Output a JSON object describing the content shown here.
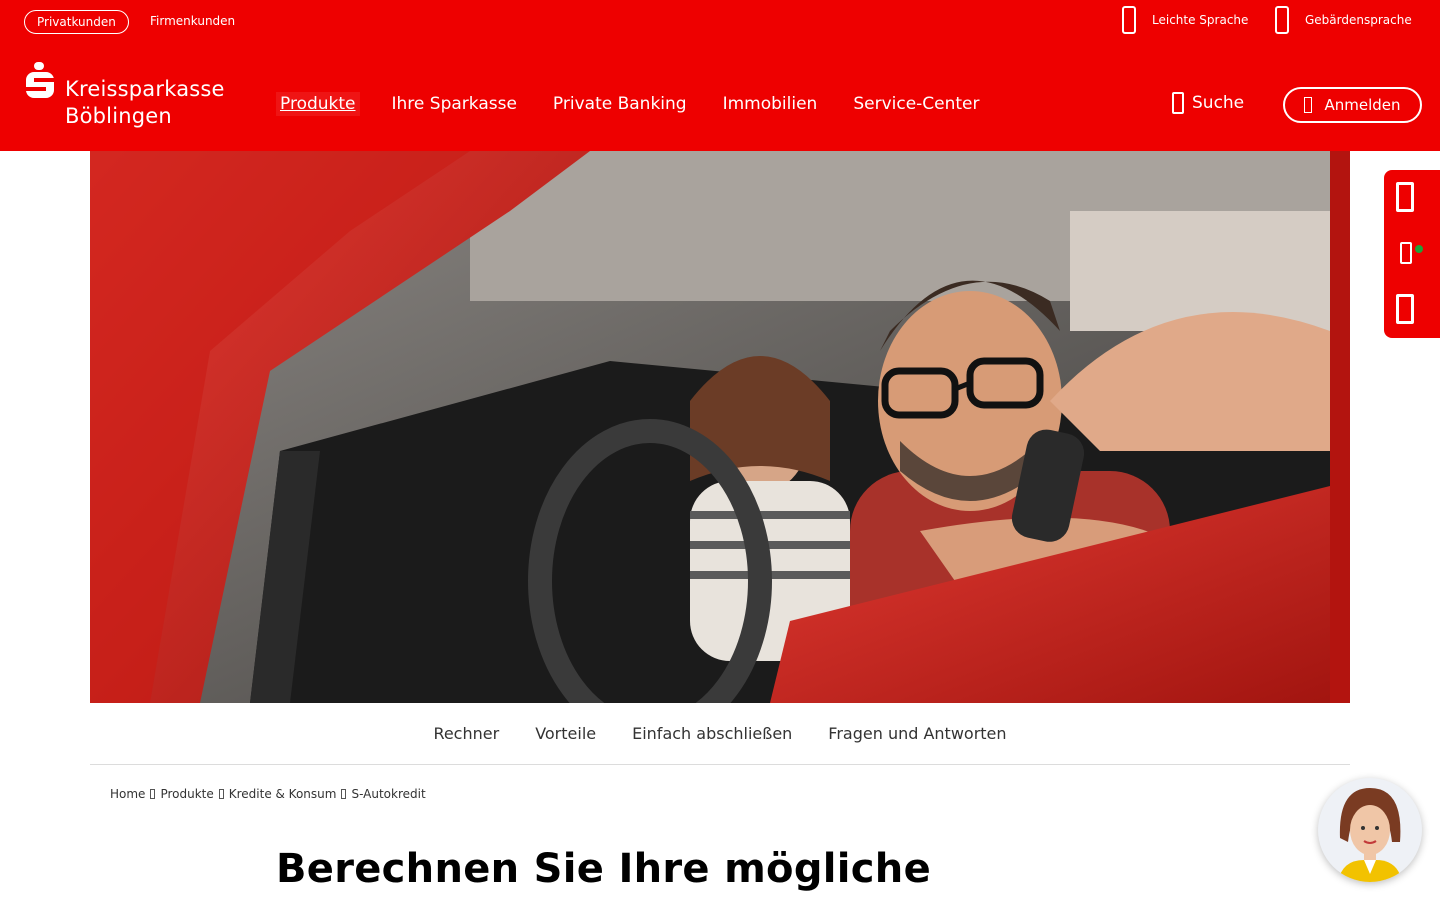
{
  "colors": {
    "brand": "#ee0000",
    "text": "#000000"
  },
  "topbar": {
    "segments": [
      "Privatkunden",
      "Firmenkunden"
    ],
    "a11y": [
      {
        "label": "Leichte Sprache",
        "icon": "easy-language-icon"
      },
      {
        "label": "Gebärdensprache",
        "icon": "sign-language-icon"
      }
    ]
  },
  "logo": {
    "line1": "Kreissparkasse",
    "line2": "Böblingen",
    "icon": "sparkasse-s-logo"
  },
  "mainnav": [
    "Produkte",
    "Ihre Sparkasse",
    "Private Banking",
    "Immobilien",
    "Service-Center"
  ],
  "search": {
    "label": "Suche",
    "icon": "search-icon"
  },
  "login": {
    "label": "Anmelden",
    "icon": "lock-icon"
  },
  "hero": {
    "alt_icon": "car-key-handover-photo"
  },
  "sidebar": {
    "icons": [
      "phone-icon",
      "chat-icon",
      "location-icon"
    ]
  },
  "subnav": [
    "Rechner",
    "Vorteile",
    "Einfach abschließen",
    "Fragen und Antworten"
  ],
  "breadcrumb": [
    "Home",
    "Produkte",
    "Kredite & Konsum",
    "S-Autokredit"
  ],
  "headline": "Berechnen Sie Ihre mögliche",
  "chat": {
    "icon": "chat-assistant-avatar"
  }
}
